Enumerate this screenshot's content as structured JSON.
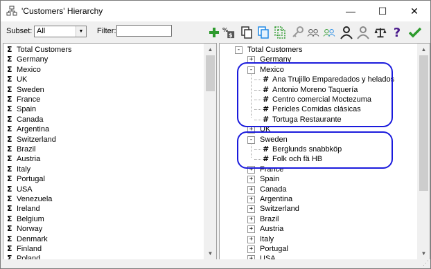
{
  "window": {
    "title": "'Customers' Hierarchy",
    "minimize_glyph": "—",
    "maximize_glyph": "☐",
    "close_glyph": "✕"
  },
  "toolbar": {
    "subset_label": "Subset:",
    "subset_value": "All",
    "filter_label": "Filter:",
    "filter_value": "",
    "icons": [
      "add-icon",
      "percent-calc-icon",
      "copy-icon",
      "paste-icon",
      "paste-dashed-icon",
      "key-icon",
      "users-icon",
      "users-green-icon",
      "user-icon",
      "user-gray-icon",
      "scale-icon",
      "help-icon",
      "check-icon"
    ]
  },
  "left_list": [
    "Total Customers",
    "Germany",
    "Mexico",
    "UK",
    "Sweden",
    "France",
    "Spain",
    "Canada",
    "Argentina",
    "Switzerland",
    "Brazil",
    "Austria",
    "Italy",
    "Portugal",
    "USA",
    "Venezuela",
    "Ireland",
    "Belgium",
    "Norway",
    "Denmark",
    "Finland",
    "Poland"
  ],
  "right_tree": [
    {
      "label": "Total Customers",
      "level": 0,
      "type": "sigma",
      "toggle": "-"
    },
    {
      "label": "Germany",
      "level": 1,
      "type": "sigma",
      "toggle": "+"
    },
    {
      "label": "Mexico",
      "level": 1,
      "type": "sigma",
      "toggle": "-"
    },
    {
      "label": "Ana Trujillo Emparedados y helados",
      "level": 2,
      "type": "hash"
    },
    {
      "label": "Antonio Moreno Taquería",
      "level": 2,
      "type": "hash"
    },
    {
      "label": "Centro comercial Moctezuma",
      "level": 2,
      "type": "hash"
    },
    {
      "label": "Pericles Comidas clásicas",
      "level": 2,
      "type": "hash"
    },
    {
      "label": "Tortuga Restaurante",
      "level": 2,
      "type": "hash"
    },
    {
      "label": "UK",
      "level": 1,
      "type": "sigma",
      "toggle": "+"
    },
    {
      "label": "Sweden",
      "level": 1,
      "type": "sigma",
      "toggle": "-"
    },
    {
      "label": "Berglunds snabbköp",
      "level": 2,
      "type": "hash"
    },
    {
      "label": "Folk och fä HB",
      "level": 2,
      "type": "hash"
    },
    {
      "label": "France",
      "level": 1,
      "type": "sigma",
      "toggle": "+"
    },
    {
      "label": "Spain",
      "level": 1,
      "type": "sigma",
      "toggle": "+"
    },
    {
      "label": "Canada",
      "level": 1,
      "type": "sigma",
      "toggle": "+"
    },
    {
      "label": "Argentina",
      "level": 1,
      "type": "sigma",
      "toggle": "+"
    },
    {
      "label": "Switzerland",
      "level": 1,
      "type": "sigma",
      "toggle": "+"
    },
    {
      "label": "Brazil",
      "level": 1,
      "type": "sigma",
      "toggle": "+"
    },
    {
      "label": "Austria",
      "level": 1,
      "type": "sigma",
      "toggle": "+"
    },
    {
      "label": "Italy",
      "level": 1,
      "type": "sigma",
      "toggle": "+"
    },
    {
      "label": "Portugal",
      "level": 1,
      "type": "sigma",
      "toggle": "+"
    },
    {
      "label": "USA",
      "level": 1,
      "type": "sigma",
      "toggle": "+"
    }
  ],
  "glyphs": {
    "sigma": "Σ",
    "hash": "#"
  },
  "colors": {
    "callout": "#1a1adc",
    "add_green": "#2e9b2e",
    "check_green": "#2e9b2e",
    "help_purple": "#4b1b8c"
  }
}
